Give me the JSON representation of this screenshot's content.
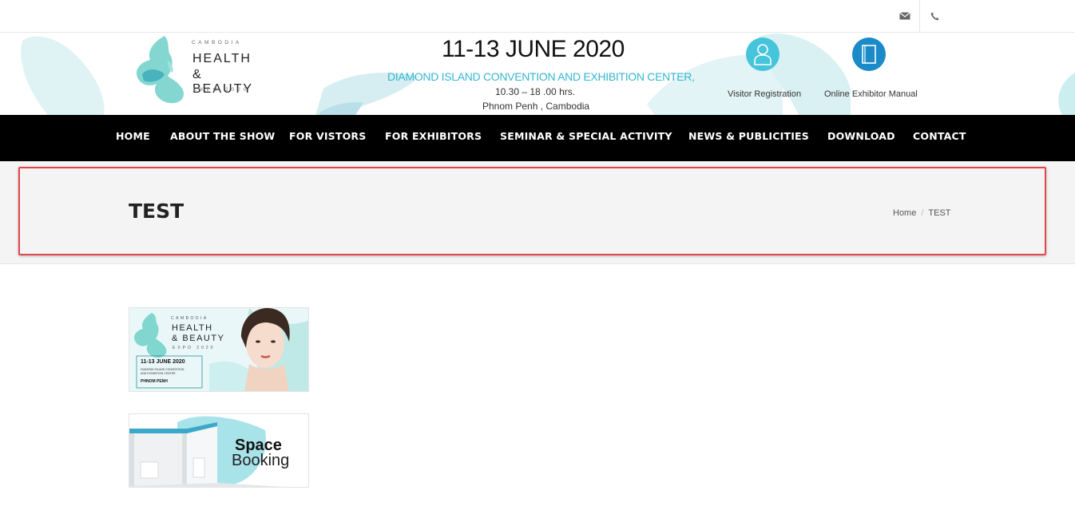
{
  "topbar": {
    "mail_icon": "envelope-icon",
    "phone_icon": "phone-icon"
  },
  "logo": {
    "country": "CAMBODIA",
    "line1": "HEALTH",
    "line2": "& BEAUTY",
    "expo": "EXPO 2020"
  },
  "event": {
    "date": "11-13 JUNE 2020",
    "venue": "DIAMOND ISLAND CONVENTION AND EXHIBITION CENTER,",
    "time": "10.30 – 18 .00 hrs.",
    "city": "Phnom Penh , Cambodia"
  },
  "header_links": {
    "visitor_registration": "Visitor Registration",
    "exhibitor_manual": "Online Exhibitor Manual"
  },
  "nav": [
    "HOME",
    "ABOUT THE SHOW",
    "FOR VISTORS",
    "FOR EXHIBITORS",
    "SEMINAR & SPECIAL ACTIVITY",
    "NEWS & PUBLICITIES",
    "DOWNLOAD",
    "CONTACT"
  ],
  "page": {
    "title": "TEST"
  },
  "breadcrumb": {
    "home": "Home",
    "separator": "/",
    "current": "TEST"
  },
  "banner1": {
    "country": "CAMBODIA",
    "line1": "HEALTH",
    "line2": "& BEAUTY",
    "expo": "EXPO 2020",
    "date": "11-13 JUNE 2020",
    "venue_line1": "DIAMOND ISLAND CONVENTION",
    "venue_line2": "AND EXHIBITION CENTER",
    "city": "PHNOM PENH"
  },
  "banner2": {
    "line1": "Space",
    "line2": "Booking"
  },
  "colors": {
    "accent": "#35b6d0",
    "nav_bg": "#000000",
    "highlight": "#e0474c",
    "manual_icon": "#1a8bc8"
  }
}
